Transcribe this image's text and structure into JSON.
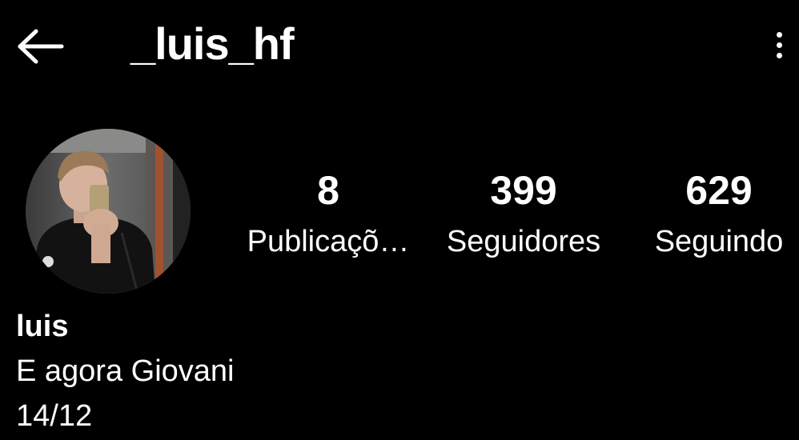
{
  "header": {
    "username": "_luis_hf",
    "back_icon": "arrow-left-icon",
    "menu_icon": "more-vertical-icon"
  },
  "profile": {
    "avatar_icon": "profile-photo",
    "stats": [
      {
        "count": "8",
        "label": "Publicaçõ…"
      },
      {
        "count": "399",
        "label": "Seguidores"
      },
      {
        "count": "629",
        "label": "Seguindo"
      }
    ],
    "display_name": "luis",
    "bio_lines": [
      "E agora Giovani",
      "14/12"
    ]
  },
  "colors": {
    "background": "#000000",
    "text": "#ffffff"
  }
}
